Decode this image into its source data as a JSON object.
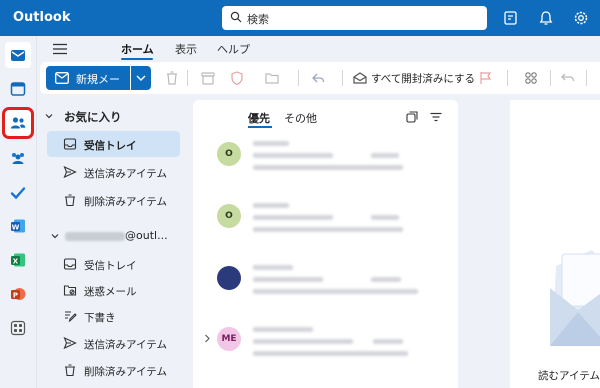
{
  "app": {
    "title": "Outlook"
  },
  "search": {
    "placeholder": "検索"
  },
  "tabs": [
    {
      "label": "ホーム",
      "active": true
    },
    {
      "label": "表示"
    },
    {
      "label": "ヘルプ"
    }
  ],
  "ribbon": {
    "new_mail_label": "新規メール",
    "mark_all_read_label": "すべて開封済みにする"
  },
  "folders": {
    "favorites_label": "お気に入り",
    "favorites": [
      {
        "label": "受信トレイ",
        "icon": "inbox-icon",
        "selected": true
      },
      {
        "label": "送信済みアイテム",
        "icon": "send-icon"
      },
      {
        "label": "削除済みアイテム",
        "icon": "trash-icon"
      }
    ],
    "account_suffix": "@outl...",
    "account_items": [
      {
        "label": "受信トレイ",
        "icon": "inbox-icon"
      },
      {
        "label": "迷惑メール",
        "icon": "junk-icon"
      },
      {
        "label": "下書き",
        "icon": "draft-icon"
      },
      {
        "label": "送信済みアイテム",
        "icon": "send-icon"
      },
      {
        "label": "削除済みアイテム",
        "icon": "trash-icon"
      }
    ]
  },
  "message_list": {
    "tab_focused": "優先",
    "tab_other": "その他",
    "messages": [
      {
        "avatar": "O",
        "avatar_color": "#c5dba0"
      },
      {
        "avatar": "O",
        "avatar_color": "#c5dba0"
      },
      {
        "avatar": "",
        "avatar_color": "#2b3a7a"
      },
      {
        "avatar": "ME",
        "avatar_color": "#f2c6e6"
      }
    ]
  },
  "reading_pane": {
    "hint": "読むアイテムを"
  },
  "colors": {
    "brand": "#0f6cbd",
    "highlight": "#e0201b"
  }
}
